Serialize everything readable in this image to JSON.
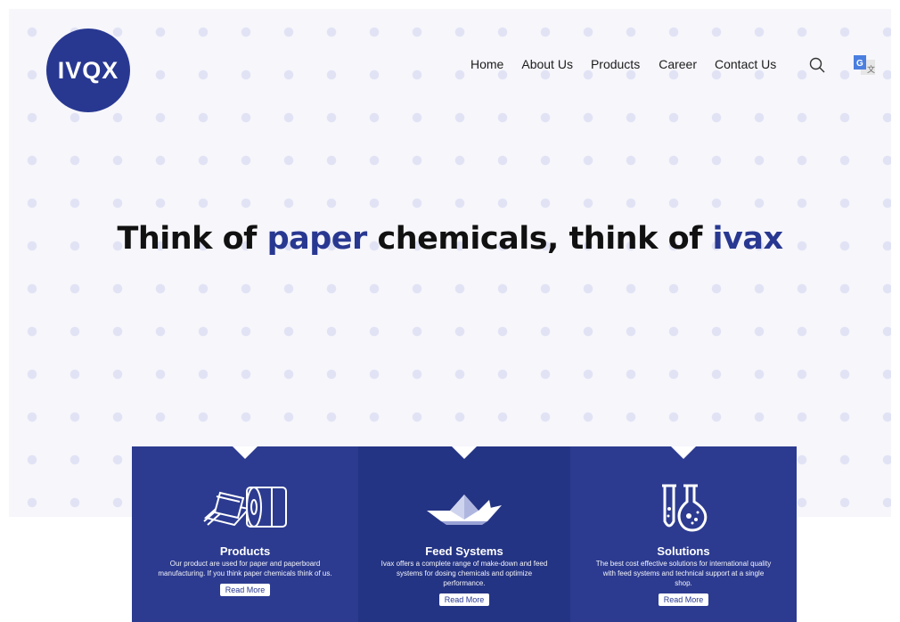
{
  "brand": {
    "logo_text": "IVQX",
    "accent_color": "#283891"
  },
  "nav": {
    "items": [
      "Home",
      "About Us",
      "Products",
      "Career",
      "Contact Us"
    ],
    "search_icon": "search-icon",
    "translate_icon": "google-translate-icon"
  },
  "hero": {
    "headline_part1": "Think of ",
    "headline_accent1": "paper",
    "headline_part2": " chemicals, think of ",
    "headline_accent2": "ivax"
  },
  "cards": [
    {
      "title": "Products",
      "description": "Our product are used for paper and paperboard manufacturing. If you think paper chemicals think of us.",
      "button": "Read More",
      "icon": "paper-roll-icon"
    },
    {
      "title": "Feed Systems",
      "description": "Ivax offers a complete range of make-down and feed systems for dosing chemicals and optimize performance.",
      "button": "Read More",
      "icon": "paper-boat-icon"
    },
    {
      "title": "Solutions",
      "description": "The best cost effective solutions for international quality with feed systems and technical support at a single shop.",
      "button": "Read More",
      "icon": "lab-flask-icon"
    }
  ]
}
